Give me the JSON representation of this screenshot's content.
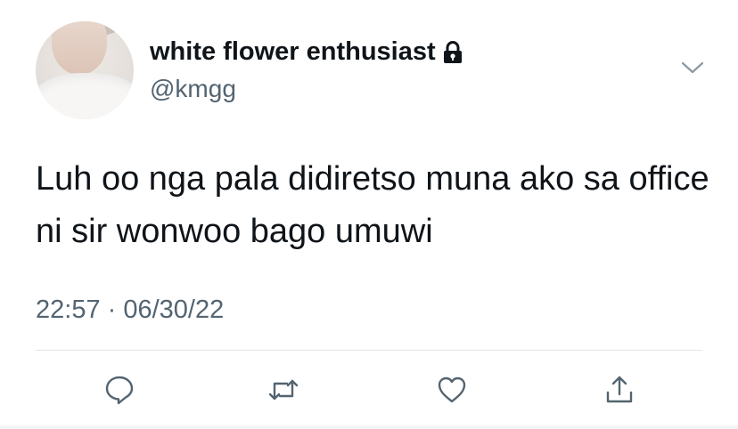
{
  "user": {
    "display_name": "white flower enthusiast",
    "handle": "@kmgg",
    "protected_icon": "lock-icon",
    "avatar": "profile-photo"
  },
  "tweet": {
    "text": "Luh oo nga pala didiretso muna ako sa office ni sir wonwoo bago umuwi",
    "timestamp": "22:57 · 06/30/22"
  },
  "menu_icon": "chevron-down-icon",
  "actions": [
    "reply-icon",
    "retweet-icon",
    "like-icon",
    "share-icon"
  ],
  "colors": {
    "text": "#0f1419",
    "secondary": "#536471",
    "divider": "#e1e6ea"
  }
}
